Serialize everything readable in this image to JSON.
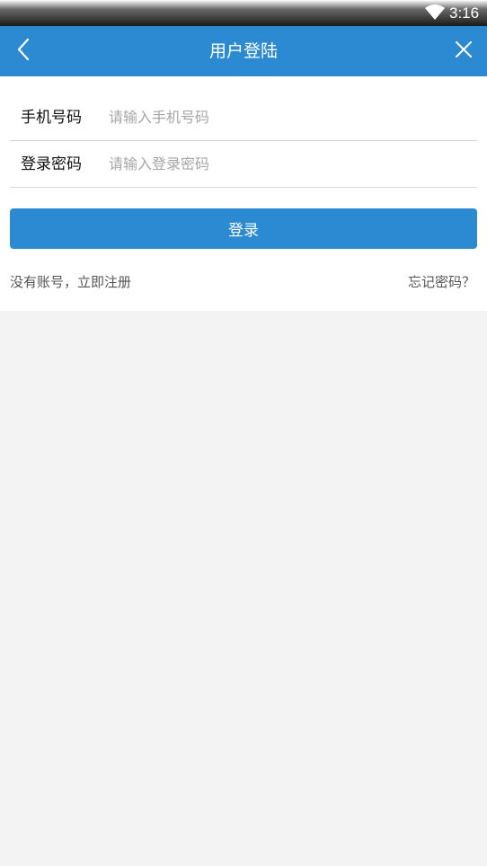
{
  "status_bar": {
    "time": "3:16",
    "wifi_icon": "wifi-icon"
  },
  "nav": {
    "title": "用户登陆",
    "back_icon": "chevron-left-icon",
    "close_icon": "close-icon",
    "color": "#2b8ad1"
  },
  "form": {
    "phone_label": "手机号码",
    "phone_placeholder": "请输入手机号码",
    "phone_value": "",
    "password_label": "登录密码",
    "password_placeholder": "请输入登录密码",
    "password_value": ""
  },
  "actions": {
    "login_label": "登录",
    "register_link": "没有账号，立即注册",
    "forgot_link": "忘记密码？"
  }
}
